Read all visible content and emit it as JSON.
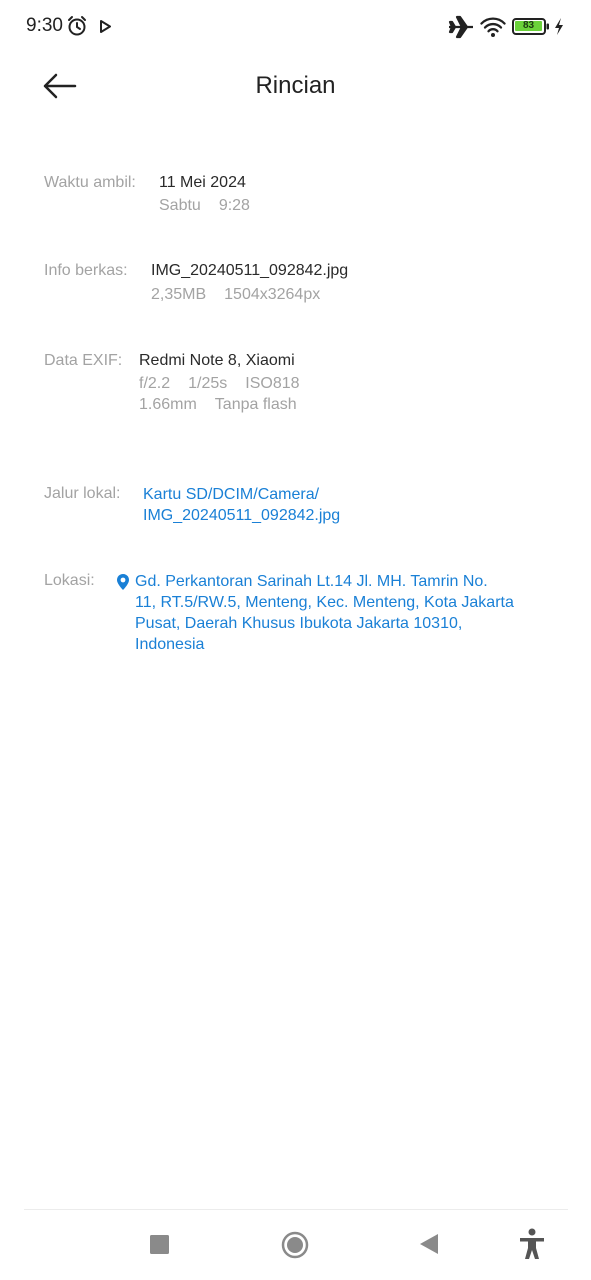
{
  "status_bar": {
    "time": "9:30",
    "battery_level": "83",
    "icons": [
      "alarm-icon",
      "play-icon",
      "airplane-icon",
      "wifi-icon",
      "battery-icon",
      "charging-icon"
    ]
  },
  "header": {
    "title": "Rincian",
    "back_icon": "arrow-left-icon"
  },
  "details": {
    "taken": {
      "label": "Waktu ambil:",
      "date": "11 Mei 2024",
      "day": "Sabtu",
      "time": "9:28"
    },
    "file": {
      "label": "Info berkas:",
      "name": "IMG_20240511_092842.jpg",
      "size": "2,35MB",
      "resolution": "1504x3264px"
    },
    "exif": {
      "label": "Data EXIF:",
      "device": "Redmi Note 8, Xiaomi",
      "aperture": "f/2.2",
      "shutter": "1/25s",
      "iso": "ISO818",
      "focal_length": "1.66mm",
      "flash": "Tanpa flash"
    },
    "path": {
      "label": "Jalur lokal:",
      "line1": "Kartu SD/DCIM/Camera/",
      "line2": "IMG_20240511_092842.jpg"
    },
    "location": {
      "label": "Lokasi:",
      "icon": "location-pin-icon",
      "line1": "Gd. Perkantoran Sarinah Lt.14 Jl. MH. Tamrin No.",
      "line2": "11, RT.5/RW.5, Menteng, Kec. Menteng, Kota Jakarta",
      "line3": "Pusat, Daerah Khusus Ibukota Jakarta 10310,",
      "line4": "Indonesia"
    }
  },
  "colors": {
    "link": "#1a80d6",
    "label": "#a3a3a3",
    "text": "#2a2a2a",
    "battery": "#6bd23a"
  },
  "nav_bar": {
    "icons": [
      "recents-square-icon",
      "home-circle-icon",
      "back-triangle-icon",
      "accessibility-icon"
    ]
  }
}
